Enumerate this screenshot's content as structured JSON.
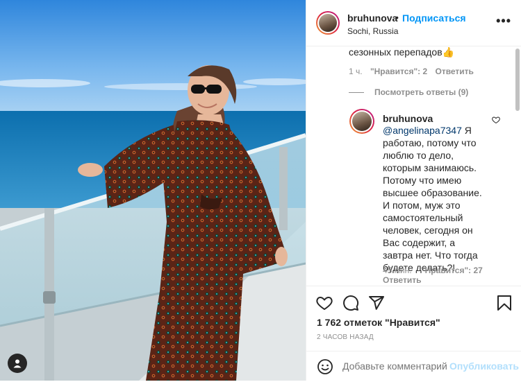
{
  "post": {
    "username": "bruhunova",
    "dot": "•",
    "follow_label": "Подписаться",
    "location": "Sochi, Russia",
    "more_label": "•••"
  },
  "comments": {
    "first_text": "сезонных перепадов👍",
    "first_time": "1 ч.",
    "first_likes": "\"Нравится\": 2",
    "first_reply_label": "Ответить",
    "view_replies": "Посмотреть ответы (9)",
    "reply": {
      "username": "bruhunova",
      "mention": "@angelinapa7347",
      "text": " Я работаю, потому что люблю то дело, которым занимаюсь. Потому что имею высшее образование. И потом, муж это самостоятельный человек, сегодня он Вас содержит, а завтра нет. Что тогда будете делать?!",
      "time": "45 мин.",
      "likes": "\"Нравится\": 27",
      "reply_label": "Ответить"
    }
  },
  "footer": {
    "likes": "1 762 отметок \"Нравится\"",
    "time": "2 ЧАСОВ НАЗАД",
    "comment_placeholder": "Добавьте комментарий...",
    "publish_label": "Опубликовать"
  },
  "icons": {
    "like": "heart-icon",
    "comment": "comment-icon",
    "share": "share-icon",
    "save": "bookmark-icon",
    "emoji": "emoji-icon",
    "tag": "user-tag-icon",
    "more": "more-options-icon"
  },
  "colors": {
    "accent": "#0095f6",
    "publish_disabled": "#b2dffc",
    "mention": "#00376b",
    "muted": "#8e8e8e"
  }
}
